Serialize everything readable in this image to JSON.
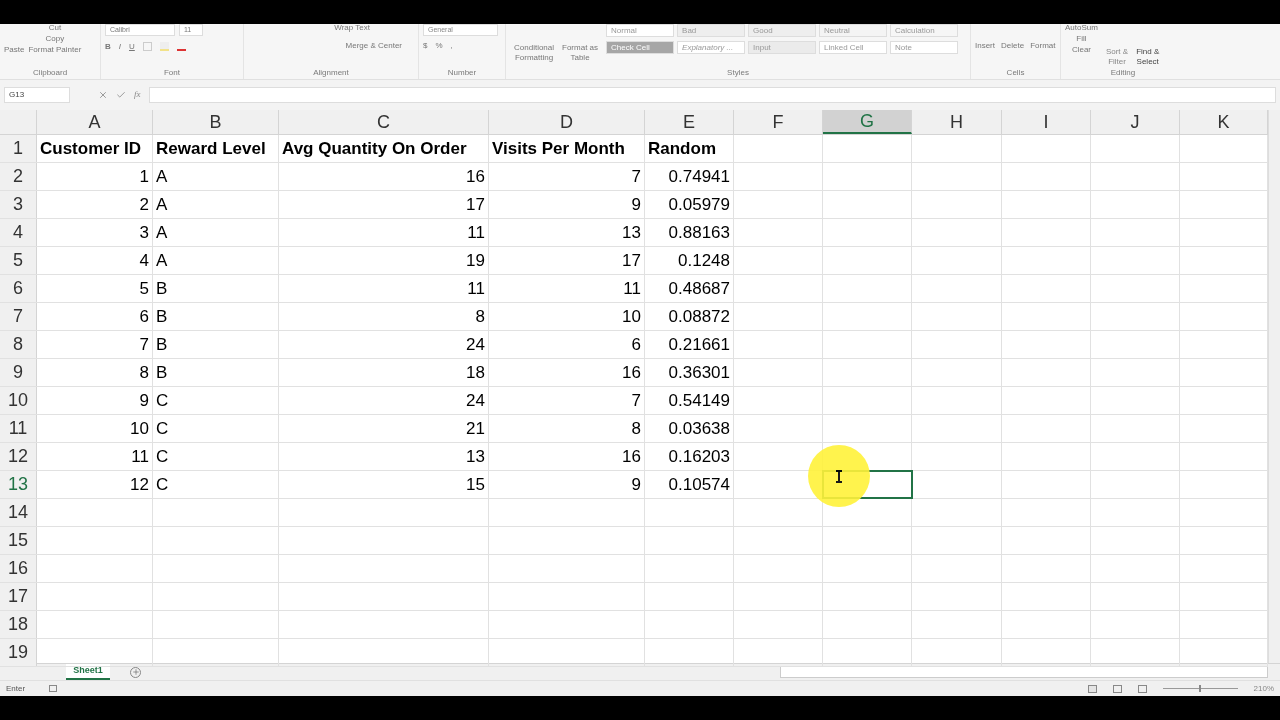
{
  "ribbon": {
    "clipboard": {
      "paste": "Paste",
      "cut": "Cut",
      "copy": "Copy",
      "format_painter": "Format Painter",
      "label": "Clipboard"
    },
    "font": {
      "name": "Calibri",
      "size": "11",
      "bold": "B",
      "italic": "I",
      "underline": "U",
      "label": "Font"
    },
    "alignment": {
      "wrap_text": "Wrap Text",
      "merge_center": "Merge & Center",
      "label": "Alignment"
    },
    "number": {
      "format": "General",
      "currency": "$",
      "percent": "%",
      "comma": ",",
      "label": "Number"
    },
    "styles": {
      "conditional": [
        "Conditional",
        "Formatting"
      ],
      "format_table": [
        "Format as",
        "Table"
      ],
      "label": "Styles",
      "tiles": [
        {
          "text": "Normal",
          "color": "#ffffff"
        },
        {
          "text": "Bad",
          "color": "#eeeeee"
        },
        {
          "text": "Good",
          "color": "#eeeeee"
        },
        {
          "text": "Neutral",
          "color": "#f4f4f4"
        },
        {
          "text": "Calculation",
          "color": "#f6f6f6"
        },
        {
          "text": "Check Cell",
          "color": "#a6a6a6"
        },
        {
          "text": "Explanatory ...",
          "color": "#ffffff"
        },
        {
          "text": "Input",
          "color": "#ebebeb"
        },
        {
          "text": "Linked Cell",
          "color": "#ffffff"
        },
        {
          "text": "Note",
          "color": "#ffffff"
        }
      ]
    },
    "cells": {
      "insert": "Insert",
      "delete": "Delete",
      "format": "Format",
      "label": "Cells"
    },
    "editing": {
      "autosum": "AutoSum",
      "fill": "Fill",
      "clear": "Clear",
      "sort": [
        "Sort &",
        "Filter"
      ],
      "find": [
        "Find &",
        "Select"
      ],
      "label": "Editing"
    }
  },
  "name_box": "G13",
  "function_label": "fx",
  "columns": [
    {
      "label": "A",
      "kind": "number",
      "selected": false
    },
    {
      "label": "B",
      "kind": "text",
      "selected": false
    },
    {
      "label": "C",
      "kind": "number",
      "selected": false
    },
    {
      "label": "D",
      "kind": "number",
      "selected": false
    },
    {
      "label": "E",
      "kind": "number",
      "selected": false
    },
    {
      "label": "F",
      "kind": "number",
      "selected": false
    },
    {
      "label": "G",
      "kind": "number",
      "selected": true
    },
    {
      "label": "H",
      "kind": "number",
      "selected": false
    },
    {
      "label": "I",
      "kind": "number",
      "selected": false
    },
    {
      "label": "J",
      "kind": "number",
      "selected": false
    },
    {
      "label": "K",
      "kind": "number",
      "selected": false
    }
  ],
  "rows": [
    {
      "number": "1",
      "kind": "header",
      "selected": false,
      "cells": [
        "Customer ID",
        "Reward Level",
        "Avg Quantity On Order",
        "Visits Per Month",
        "Random"
      ]
    },
    {
      "number": "2",
      "kind": "data",
      "selected": false,
      "cells": [
        "1",
        "A",
        "16",
        "7",
        "0.74941"
      ]
    },
    {
      "number": "3",
      "kind": "data",
      "selected": false,
      "cells": [
        "2",
        "A",
        "17",
        "9",
        "0.05979"
      ]
    },
    {
      "number": "4",
      "kind": "data",
      "selected": false,
      "cells": [
        "3",
        "A",
        "11",
        "13",
        "0.88163"
      ]
    },
    {
      "number": "5",
      "kind": "data",
      "selected": false,
      "cells": [
        "4",
        "A",
        "19",
        "17",
        "0.1248"
      ]
    },
    {
      "number": "6",
      "kind": "data",
      "selected": false,
      "cells": [
        "5",
        "B",
        "11",
        "11",
        "0.48687"
      ]
    },
    {
      "number": "7",
      "kind": "data",
      "selected": false,
      "cells": [
        "6",
        "B",
        "8",
        "10",
        "0.08872"
      ]
    },
    {
      "number": "8",
      "kind": "data",
      "selected": false,
      "cells": [
        "7",
        "B",
        "24",
        "6",
        "0.21661"
      ]
    },
    {
      "number": "9",
      "kind": "data",
      "selected": false,
      "cells": [
        "8",
        "B",
        "18",
        "16",
        "0.36301"
      ]
    },
    {
      "number": "10",
      "kind": "data",
      "selected": false,
      "cells": [
        "9",
        "C",
        "24",
        "7",
        "0.54149"
      ]
    },
    {
      "number": "11",
      "kind": "data",
      "selected": false,
      "cells": [
        "10",
        "C",
        "21",
        "8",
        "0.03638"
      ]
    },
    {
      "number": "12",
      "kind": "data",
      "selected": false,
      "cells": [
        "11",
        "C",
        "13",
        "16",
        "0.16203"
      ]
    },
    {
      "number": "13",
      "kind": "data",
      "selected": true,
      "cells": [
        "12",
        "C",
        "15",
        "9",
        "0.10574"
      ]
    },
    {
      "number": "14",
      "kind": "data",
      "selected": false
    },
    {
      "number": "15",
      "kind": "data",
      "selected": false
    },
    {
      "number": "16",
      "kind": "data",
      "selected": false
    },
    {
      "number": "17",
      "kind": "data",
      "selected": false
    },
    {
      "number": "18",
      "kind": "data",
      "selected": false
    },
    {
      "number": "19",
      "kind": "data",
      "selected": false
    }
  ],
  "sheets": [
    {
      "name": "Sheet1",
      "selected": true
    }
  ],
  "status": {
    "mode": "Enter",
    "zoom_slider": {
      "level": 0.5
    },
    "zoom": "210%"
  }
}
